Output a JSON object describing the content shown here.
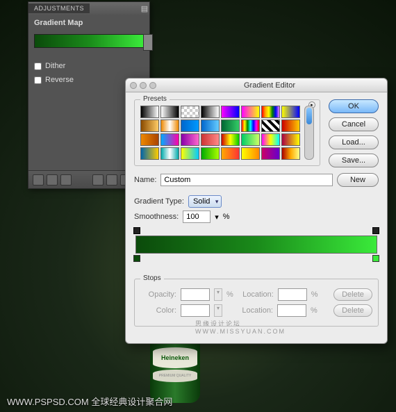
{
  "canvas": {
    "bottle_label": "Heineken",
    "bottle_band": "PREMIUM QUALITY"
  },
  "watermark": "WWW.PSPSD.COM 全球经典设计聚合网",
  "watermark_center": "思缘设计论坛  WWW.MISSYUAN.COM",
  "adjustments": {
    "panel_title": "ADJUSTMENTS",
    "title": "Gradient Map",
    "dither": "Dither",
    "reverse": "Reverse"
  },
  "dialog": {
    "title": "Gradient Editor",
    "presets_label": "Presets",
    "name_label": "Name:",
    "name_value": "Custom",
    "new_btn": "New",
    "gradient_type_label": "Gradient Type:",
    "gradient_type_value": "Solid",
    "smoothness_label": "Smoothness:",
    "smoothness_value": "100",
    "percent": "%",
    "stops_label": "Stops",
    "opacity_label": "Opacity:",
    "color_label": "Color:",
    "location_label": "Location:",
    "delete": "Delete",
    "ok": "OK",
    "cancel": "Cancel",
    "load": "Load...",
    "save": "Save..."
  },
  "swatches": [
    "linear-gradient(90deg,#000,#fff)",
    "linear-gradient(90deg,#fff,#000)",
    "repeating-conic-gradient(#ccc 0 25%,#fff 0 50%) 0/8px 8px",
    "linear-gradient(90deg,#000,#888,#fff)",
    "linear-gradient(90deg,#f0f,#00f)",
    "linear-gradient(90deg,#f0f,#ff0)",
    "linear-gradient(90deg,red,orange,yellow,green,blue,violet)",
    "linear-gradient(90deg,#ff0,#00f)",
    "linear-gradient(90deg,#8a4a00,#ffcc66)",
    "linear-gradient(90deg,#e80,#fff,#e80)",
    "linear-gradient(90deg,#06c,#09f)",
    "linear-gradient(90deg,#06c,#6cf)",
    "linear-gradient(90deg,#063,#3c6)",
    "linear-gradient(90deg,red,yellow,green,cyan,blue,magenta,red)",
    "repeating-linear-gradient(45deg,#000 0 4px,#fff 4px 8px)",
    "linear-gradient(90deg,#c00,#fc0)",
    "linear-gradient(90deg,#e80,#a40)",
    "linear-gradient(90deg,#0af,#f0a)",
    "linear-gradient(90deg,#8800aa,#ff66cc)",
    "linear-gradient(90deg,#cc3333,#f88)",
    "linear-gradient(90deg,#c00,#ff0,#0c0)",
    "linear-gradient(90deg,#0c6,#cf6)",
    "linear-gradient(90deg,#f0f,#ff0,#0ff)",
    "linear-gradient(90deg,#a04,#ff0)",
    "linear-gradient(90deg,#06a,#fc0)",
    "linear-gradient(90deg,#0aa,#fff,#0aa)",
    "linear-gradient(90deg,#ff0,#0cf)",
    "linear-gradient(90deg,#0a0,#af0)",
    "linear-gradient(90deg,#fa0,#f33)",
    "linear-gradient(90deg,#ff0,#f80)",
    "linear-gradient(90deg,#c06,#60c)",
    "linear-gradient(90deg,#a00,#fa0,#ff8)"
  ]
}
